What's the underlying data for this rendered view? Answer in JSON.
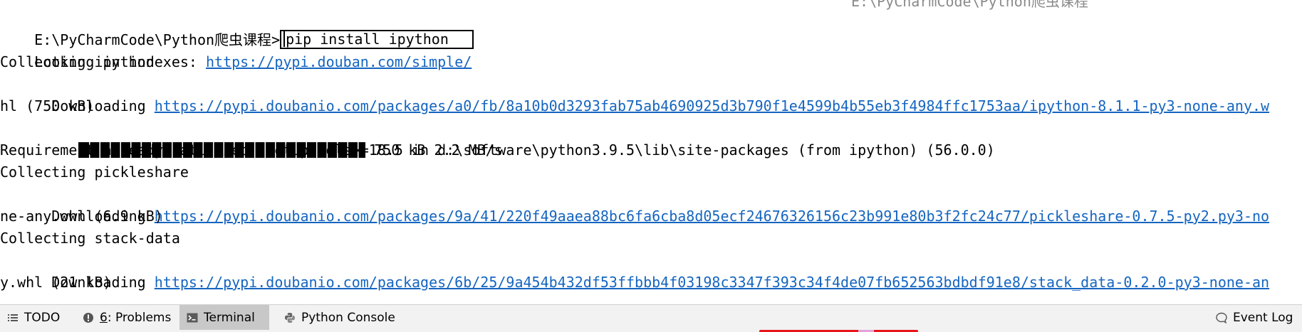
{
  "terminal": {
    "ghost_text": "E:\\PyCharmCode\\Python爬虫课程",
    "prompt_path": "E:\\PyCharmCode\\Python爬虫课程>",
    "command": "pip install ipython",
    "lines": {
      "l1_prefix": "Looking in indexes: ",
      "l1_link": "https://pypi.douban.com/simple/",
      "l2": "Collecting ipython",
      "l3_prefix": "  Downloading ",
      "l3_link": "https://pypi.doubanio.com/packages/a0/fb/8a10b0d3293fab75ab4690925d3b790f1e4599b4b55eb3f4984ffc1753aa/ipython-8.1.1-py3-none-any.w",
      "l4": "hl (750 kB)",
      "l5_suffix": " 750 kB 2.2 MB/s",
      "l6": "Requirement already satisfied: setuptools>=18.5 in d:\\software\\python3.9.5\\lib\\site-packages (from ipython) (56.0.0)",
      "l7": "Collecting pickleshare",
      "l8_prefix": "  Downloading ",
      "l8_link": "https://pypi.doubanio.com/packages/9a/41/220f49aaea88bc6fa6cba8d05ecf24676326156c23b991e80b3f2fc24c77/pickleshare-0.7.5-py2.py3-no",
      "l9": "ne-any.whl (6.9 kB)",
      "l10": "Collecting stack-data",
      "l11_prefix": "  Downloading ",
      "l11_link": "https://pypi.doubanio.com/packages/6b/25/9a454b432df53ffbbb4f03198c3347f393c34f4de07fb652563bdbdf91e8/stack_data-0.2.0-py3-none-an",
      "l12": "y.whl (21 kB)"
    },
    "progress": {
      "fraction": 1.0
    }
  },
  "toolbar": {
    "todo_label": "TODO",
    "problems_count": "6",
    "problems_label": ": Problems",
    "terminal_label": "Terminal",
    "python_console_label": "Python Console",
    "event_log_label": "Event Log"
  },
  "icons": {
    "todo": "list-icon",
    "problems": "warning-circle-icon",
    "terminal": "terminal-icon",
    "python_console": "python-icon",
    "event_log": "bubble-icon"
  },
  "colors": {
    "link": "#1565c0",
    "active_tab": "#c8c8c8",
    "toolbar_bg": "#f2f2f2",
    "accent_red": "#e8151b"
  }
}
